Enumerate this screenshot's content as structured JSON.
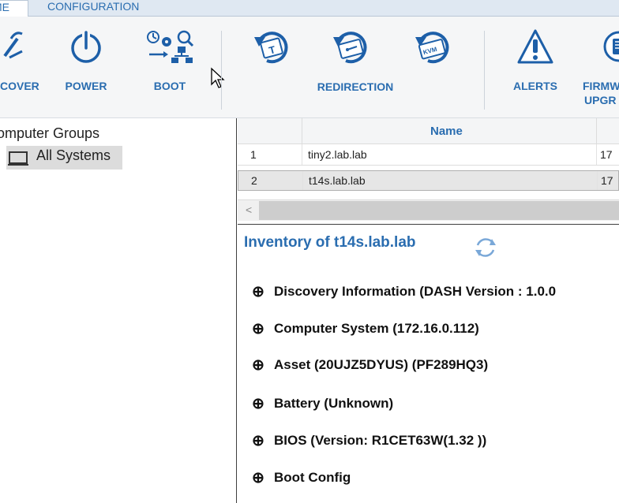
{
  "tabs": [
    {
      "label": "ME"
    },
    {
      "label": "CONFIGURATION"
    }
  ],
  "ribbon": {
    "buttons": [
      {
        "label": "COVER",
        "icon": "discover-icon"
      },
      {
        "label": "POWER",
        "icon": "power-icon"
      },
      {
        "label": "BOOT",
        "icon": "boot-icon"
      },
      {
        "label": "REDIRECTION",
        "icon": "redirection-icons"
      },
      {
        "label": "ALERTS",
        "icon": "alert-icon"
      },
      {
        "label_line1": "FIRMW",
        "label_line2": "UPGR",
        "icon": "firmware-icon"
      }
    ]
  },
  "tree": {
    "root": "omputer Groups",
    "node": "All Systems"
  },
  "grid": {
    "column_name": "Name",
    "rows": [
      {
        "num": "1",
        "host": "tiny2.lab.lab",
        "ip": "17"
      },
      {
        "num": "2",
        "host": "t14s.lab.lab",
        "ip": "17"
      }
    ],
    "scroll_left": "<"
  },
  "inventory": {
    "title": "Inventory of t14s.lab.lab",
    "sections": [
      {
        "label": "Discovery Information (DASH Version : 1.0.0"
      },
      {
        "label": "Computer System (172.16.0.112)"
      },
      {
        "label": "Asset (20UJZ5DYUS) (PF289HQ3)"
      },
      {
        "label": "Battery (Unknown)"
      },
      {
        "label": "BIOS (Version: R1CET63W(1.32 ))"
      },
      {
        "label": "Boot Config"
      }
    ],
    "expand_glyph": "⊕"
  },
  "colors": {
    "accent": "#2a6db0",
    "ribbon_bg": "#f5f6f7",
    "selection": "#dcdcdc"
  }
}
